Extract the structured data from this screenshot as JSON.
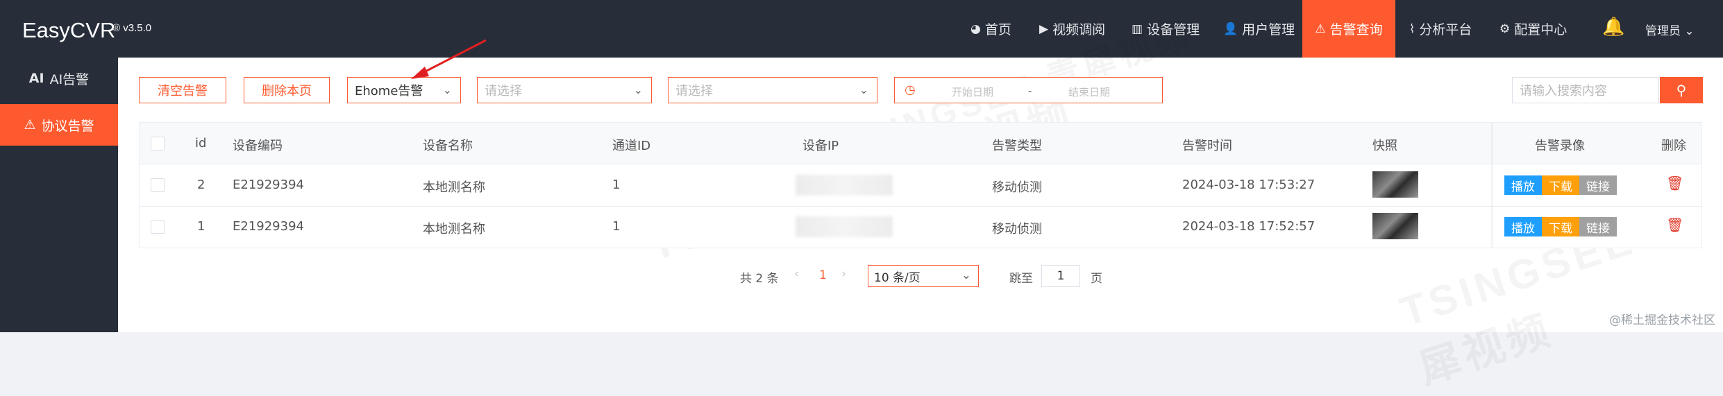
{
  "app": {
    "title": "EasyCVR",
    "version": "® v3.5.0"
  },
  "nav": [
    {
      "icon": "dashboard-icon",
      "glyph": "◕",
      "label": "首页"
    },
    {
      "icon": "play-icon",
      "glyph": "▶",
      "label": "视频调阅"
    },
    {
      "icon": "device-icon",
      "glyph": "▥",
      "label": "设备管理"
    },
    {
      "icon": "user-icon",
      "glyph": "👤",
      "label": "用户管理"
    },
    {
      "icon": "alarm-icon",
      "glyph": "⚠",
      "label": "告警查询"
    },
    {
      "icon": "pulse-icon",
      "glyph": "⌇",
      "label": "分析平台"
    },
    {
      "icon": "gear-icon",
      "glyph": "⚙",
      "label": "配置中心"
    }
  ],
  "user": {
    "name": "管理员",
    "dropdown": "⌄"
  },
  "sidebar": [
    {
      "icon": "ai-icon",
      "glyph": "AI",
      "label": "AI告警"
    },
    {
      "icon": "alarm-icon",
      "glyph": "⚠",
      "label": "协议告警"
    }
  ],
  "toolbar": {
    "clear_label": "清空告警",
    "delete_page_label": "删除本页",
    "protocol_select": "Ehome告警",
    "select_placeholder_1": "请选择",
    "select_placeholder_2": "请选择",
    "start_date": "开始日期",
    "date_sep": "-",
    "end_date": "结束日期",
    "search_placeholder": "请输入搜索内容",
    "search_glyph": "⚲"
  },
  "table": {
    "columns": [
      "id",
      "设备编码",
      "设备名称",
      "通道ID",
      "设备IP",
      "告警类型",
      "告警时间",
      "快照",
      "告警录像",
      "删除"
    ],
    "rows": [
      {
        "id": "2",
        "device_code": "E21929394",
        "device_name": "本地测名称",
        "channel_id": "1",
        "device_ip": "",
        "alarm_type": "移动侦测",
        "alarm_time": "2024-03-18 17:53:27"
      },
      {
        "id": "1",
        "device_code": "E21929394",
        "device_name": "本地测名称",
        "channel_id": "1",
        "device_ip": "",
        "alarm_type": "移动侦测",
        "alarm_time": "2024-03-18 17:52:57"
      }
    ],
    "actions": {
      "play": "播放",
      "download": "下载",
      "link": "链接"
    },
    "colors": {
      "play": "#1e9fff",
      "download": "#ff9f0a",
      "link": "#a0a0a0"
    }
  },
  "pagination": {
    "total": "共 2 条",
    "prev": "‹",
    "current": "1",
    "next": "›",
    "page_size": "10 条/页",
    "goto": "跳至",
    "goto_value": "1",
    "page_unit": "页"
  },
  "watermark": "TSINGSEE 青犀视频",
  "credit": "@稀土掘金技术社区",
  "colors": {
    "accent": "#fd5a2f",
    "nav_bg": "#272e3a"
  }
}
